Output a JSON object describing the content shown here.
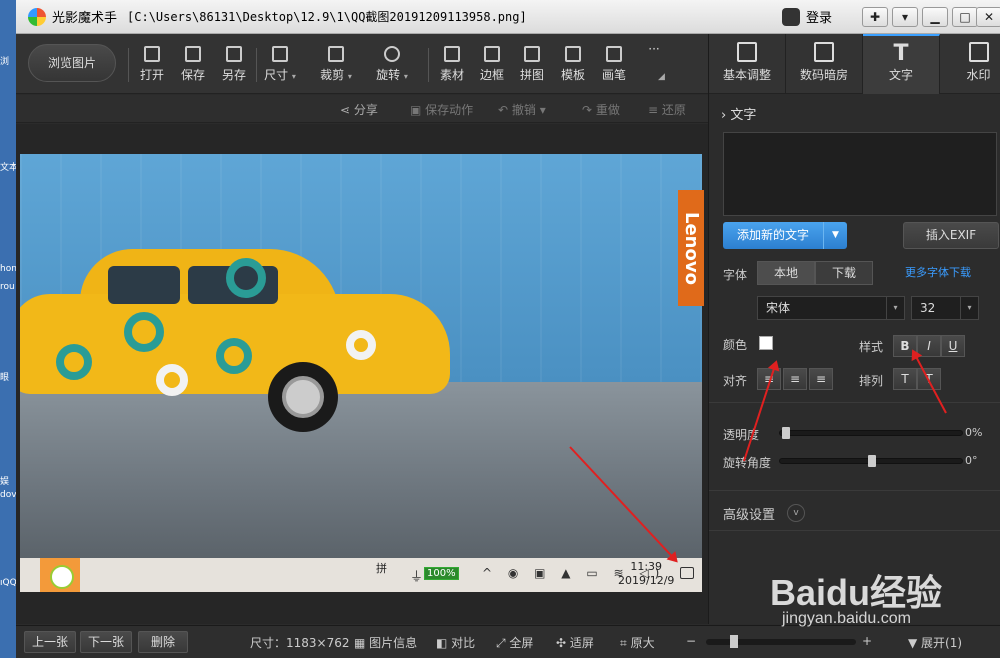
{
  "window": {
    "app_name": "光影魔术手",
    "file_path": "[C:\\Users\\86131\\Desktop\\12.9\\1\\QQ截图20191209113958.png]",
    "login_label": "登录"
  },
  "desktop_strip": [
    "浏",
    "文本",
    "hon",
    "rou",
    "眼",
    "娱",
    "dov",
    "ıQQ"
  ],
  "toolbar": {
    "browse_label": "浏览图片",
    "items": [
      "打开",
      "保存",
      "另存",
      "尺寸",
      "裁剪",
      "旋转",
      "素材",
      "边框",
      "拼图",
      "模板",
      "画笔"
    ],
    "more_label": "···"
  },
  "actions": {
    "share": "分享",
    "save_action": "保存动作",
    "undo": "撤销",
    "redo": "重做",
    "restore": "还原"
  },
  "photo": {
    "brand_text": "Lenovo",
    "taskbar": {
      "ime_label": "拼",
      "battery": "100%",
      "time": "11:39",
      "date": "2019/12/9"
    }
  },
  "right_panel": {
    "tabs": [
      "基本调整",
      "数码暗房",
      "文字",
      "水印"
    ],
    "active_tab": "文字",
    "section_title": "文字",
    "add_text_label": "添加新的文字",
    "insert_exif_label": "插入EXIF",
    "font_label": "字体",
    "font_local": "本地",
    "font_download": "下载",
    "more_fonts_link": "更多字体下载",
    "font_name": "宋体",
    "font_size": "32",
    "color_label": "颜色",
    "color_value": "#ffffff",
    "style_label": "样式",
    "style_buttons": [
      "B",
      "I",
      "U"
    ],
    "align_label": "对齐",
    "arrange_label": "排列",
    "opacity_label": "透明度",
    "opacity_value": "0%",
    "rotation_label": "旋转角度",
    "rotation_value": "0°",
    "advanced_label": "高级设置"
  },
  "bottom": {
    "prev": "上一张",
    "next": "下一张",
    "delete": "删除",
    "size_label": "尺寸：1183×762",
    "info": "图片信息",
    "compare": "对比",
    "fullscreen": "全屏",
    "fit": "适屏",
    "original": "原大",
    "minus": "−",
    "plus": "+",
    "expand": "展开(1)"
  },
  "watermark": {
    "brand": "Baidu经验",
    "url": "jingyan.baidu.com"
  },
  "colors": {
    "accent": "#3a9cff",
    "annotation_arrow": "#e02020"
  }
}
